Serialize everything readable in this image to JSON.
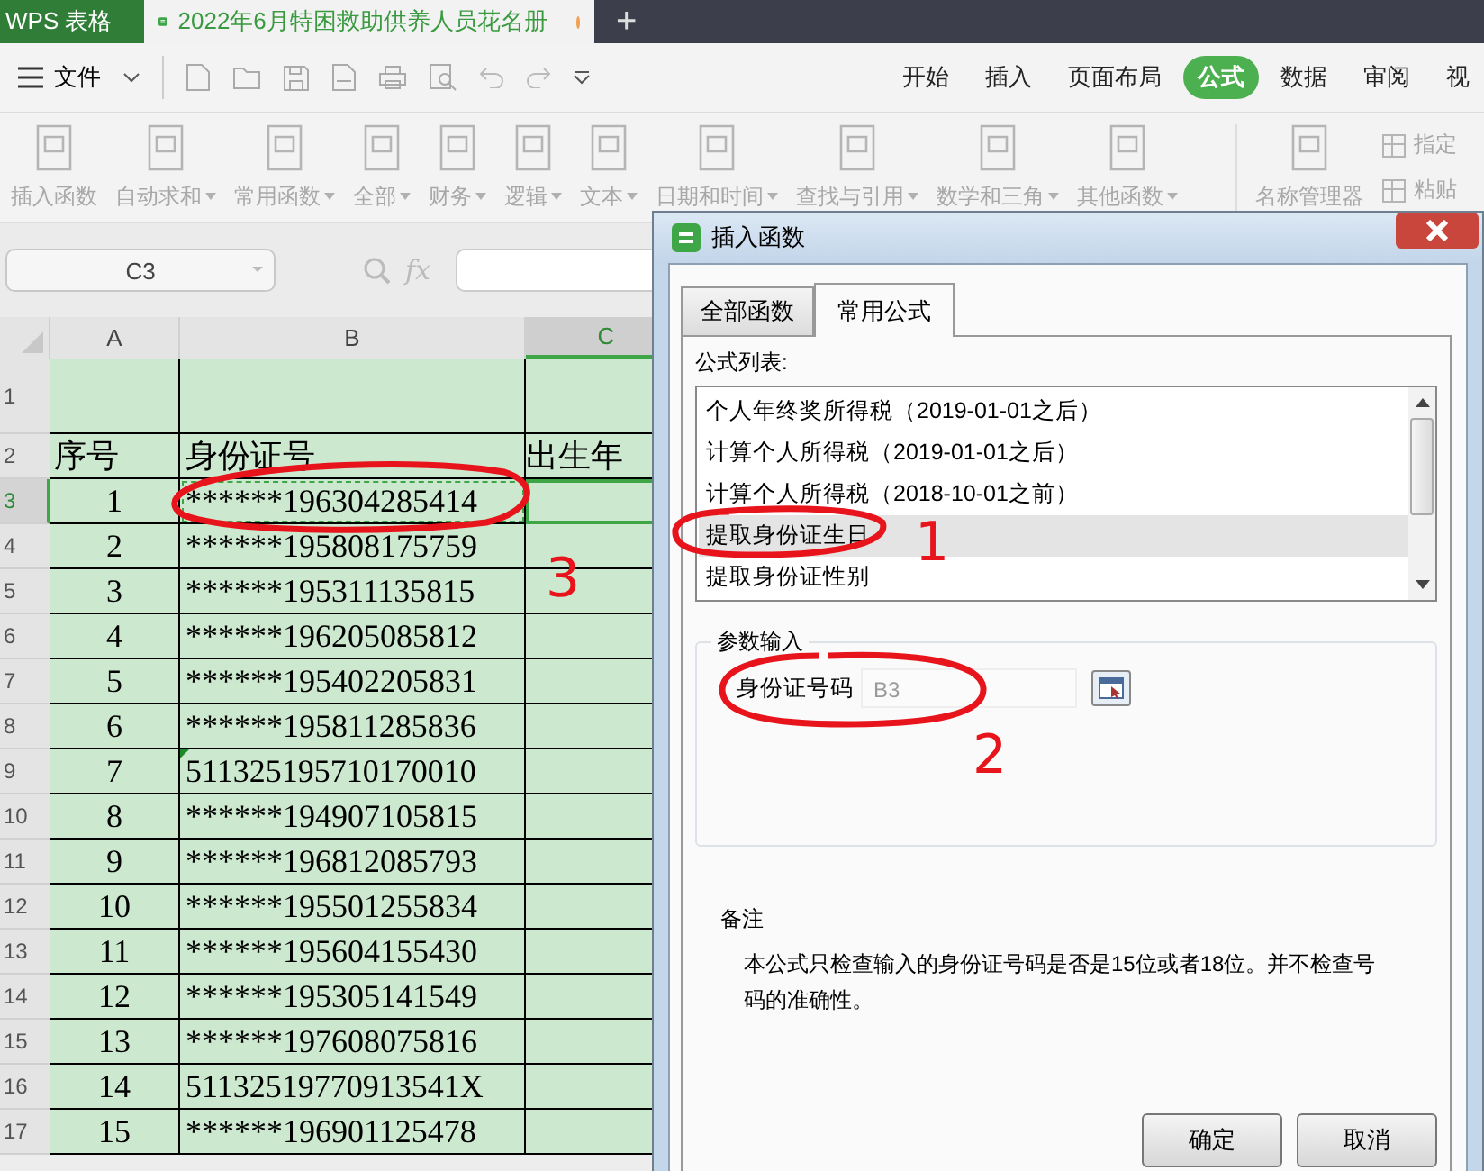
{
  "title_bar": {
    "app_label": "WPS 表格",
    "document_tab": {
      "title": "2022年6月特困救助供养人员花名册",
      "unsaved": true
    },
    "new_tab": "+"
  },
  "menu": {
    "file_label": "文件"
  },
  "ribbon_tabs": [
    {
      "label": "开始",
      "selected": false
    },
    {
      "label": "插入",
      "selected": false
    },
    {
      "label": "页面布局",
      "selected": false
    },
    {
      "label": "公式",
      "selected": true
    },
    {
      "label": "数据",
      "selected": false
    },
    {
      "label": "审阅",
      "selected": false
    },
    {
      "label": "视",
      "selected": false
    }
  ],
  "ribbon_items": [
    {
      "label": "插入函数",
      "dropdown": false
    },
    {
      "label": "自动求和",
      "dropdown": true
    },
    {
      "label": "常用函数",
      "dropdown": true
    },
    {
      "label": "全部",
      "dropdown": true
    },
    {
      "label": "财务",
      "dropdown": true
    },
    {
      "label": "逻辑",
      "dropdown": true
    },
    {
      "label": "文本",
      "dropdown": true
    },
    {
      "label": "日期和时间",
      "dropdown": true
    },
    {
      "label": "查找与引用",
      "dropdown": true
    },
    {
      "label": "数学和三角",
      "dropdown": true
    },
    {
      "label": "其他函数",
      "dropdown": true
    },
    {
      "label": "名称管理器",
      "dropdown": false
    }
  ],
  "ribbon_small_items": [
    {
      "label": "指定"
    },
    {
      "label": "粘贴"
    }
  ],
  "formula_bar": {
    "cell_ref": "C3",
    "fx_label": "fx"
  },
  "sheet": {
    "columns": [
      {
        "label": "A",
        "selected": false
      },
      {
        "label": "B",
        "selected": false
      },
      {
        "label": "C",
        "selected": true
      }
    ],
    "rows": [
      {
        "header": "1",
        "kind": "blank",
        "active": false,
        "marquee": false,
        "flag": false
      },
      {
        "header": "2",
        "kind": "heading",
        "seq": "序号",
        "id": "身份证号",
        "col_c": "出生年",
        "active": false,
        "marquee": false,
        "flag": false
      },
      {
        "header": "3",
        "kind": "data",
        "seq": "1",
        "id": "******196304285414",
        "active": true,
        "marquee": true,
        "flag": false
      },
      {
        "header": "4",
        "kind": "data",
        "seq": "2",
        "id": "******195808175759",
        "active": false,
        "marquee": false,
        "flag": false
      },
      {
        "header": "5",
        "kind": "data",
        "seq": "3",
        "id": "******195311135815",
        "active": false,
        "marquee": false,
        "flag": false
      },
      {
        "header": "6",
        "kind": "data",
        "seq": "4",
        "id": "******196205085812",
        "active": false,
        "marquee": false,
        "flag": false
      },
      {
        "header": "7",
        "kind": "data",
        "seq": "5",
        "id": "******195402205831",
        "active": false,
        "marquee": false,
        "flag": false
      },
      {
        "header": "8",
        "kind": "data",
        "seq": "6",
        "id": "******195811285836",
        "active": false,
        "marquee": false,
        "flag": false
      },
      {
        "header": "9",
        "kind": "data",
        "seq": "7",
        "id": "511325195710170010",
        "active": false,
        "marquee": false,
        "flag": true
      },
      {
        "header": "10",
        "kind": "data",
        "seq": "8",
        "id": "******194907105815",
        "active": false,
        "marquee": false,
        "flag": false
      },
      {
        "header": "11",
        "kind": "data",
        "seq": "9",
        "id": "******196812085793",
        "active": false,
        "marquee": false,
        "flag": false
      },
      {
        "header": "12",
        "kind": "data",
        "seq": "10",
        "id": "******195501255834",
        "active": false,
        "marquee": false,
        "flag": false
      },
      {
        "header": "13",
        "kind": "data",
        "seq": "11",
        "id": "******195604155430",
        "active": false,
        "marquee": false,
        "flag": false
      },
      {
        "header": "14",
        "kind": "data",
        "seq": "12",
        "id": "******195305141549",
        "active": false,
        "marquee": false,
        "flag": false
      },
      {
        "header": "15",
        "kind": "data",
        "seq": "13",
        "id": "******197608075816",
        "active": false,
        "marquee": false,
        "flag": false
      },
      {
        "header": "16",
        "kind": "data",
        "seq": "14",
        "id": "51132519770913541X",
        "active": false,
        "marquee": false,
        "flag": false
      },
      {
        "header": "17",
        "kind": "data",
        "seq": "15",
        "id": "******196901125478",
        "active": false,
        "marquee": false,
        "flag": false
      }
    ]
  },
  "dialog": {
    "title": "插入函数",
    "tabs": [
      {
        "label": "全部函数",
        "selected": false
      },
      {
        "label": "常用公式",
        "selected": true
      }
    ],
    "list_label": "公式列表:",
    "formulas": [
      {
        "label": "个人年终奖所得税（2019-01-01之后）",
        "selected": false
      },
      {
        "label": "计算个人所得税（2019-01-01之后）",
        "selected": false
      },
      {
        "label": "计算个人所得税（2018-10-01之前）",
        "selected": false
      },
      {
        "label": "提取身份证生日",
        "selected": true
      },
      {
        "label": "提取身份证性别",
        "selected": false
      }
    ],
    "params_legend": "参数输入",
    "param": {
      "label": "身份证号码",
      "value": "B3"
    },
    "note_title": "备注",
    "note": "本公式只检查输入的身份证号码是否是15位或者18位。并不检查号码的准确性。",
    "buttons": [
      {
        "label": "确定"
      },
      {
        "label": "取消"
      }
    ]
  },
  "annotations": [
    {
      "label": "3"
    },
    {
      "label": "1"
    },
    {
      "label": "2"
    }
  ]
}
